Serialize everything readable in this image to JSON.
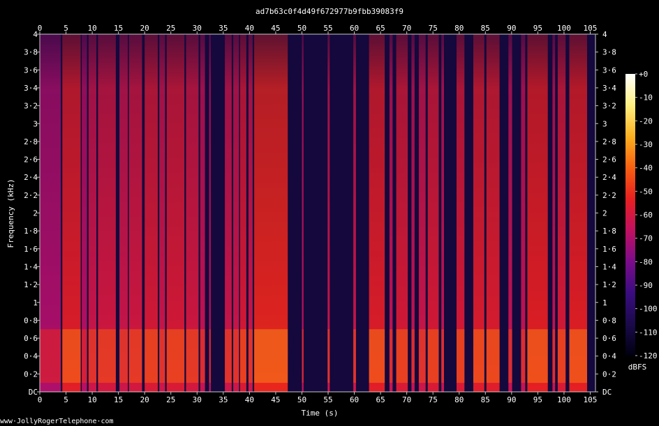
{
  "chart_data": {
    "type": "heatmap",
    "title": "ad7b63c0f4d49f672977b9fbb39083f9",
    "xlabel": "Time (s)",
    "ylabel": "Frequency (kHz)",
    "xlim": [
      0,
      106
    ],
    "ylim": [
      0,
      4
    ],
    "x_ticks": [
      "0",
      "5",
      "10",
      "15",
      "20",
      "25",
      "30",
      "35",
      "40",
      "45",
      "50",
      "55",
      "60",
      "65",
      "70",
      "75",
      "80",
      "85",
      "90",
      "95",
      "100",
      "105"
    ],
    "y_ticks": [
      "DC",
      "0·2",
      "0·4",
      "0·6",
      "0·8",
      "1",
      "1·2",
      "1·4",
      "1·6",
      "1·8",
      "2",
      "2·2",
      "2·4",
      "2·6",
      "2·8",
      "3",
      "3·2",
      "3·4",
      "3·6",
      "3·8",
      "4"
    ],
    "colorbar": {
      "label": "dBFS",
      "ticks": [
        "+0",
        "-10",
        "-20",
        "-30",
        "-40",
        "-50",
        "-60",
        "-70",
        "-80",
        "-90",
        "-100",
        "-110",
        "-120"
      ],
      "range": [
        -120,
        0
      ],
      "colors": [
        "#000010",
        "#1a0a4a",
        "#3a0c80",
        "#7a0c8a",
        "#c01060",
        "#e82020",
        "#f86010",
        "#fcb020",
        "#fff080",
        "#ffffff"
      ]
    },
    "background_level_dbfs": -110,
    "speech_segments": [
      {
        "start": 0.0,
        "end": 4.0,
        "level": -70
      },
      {
        "start": 4.3,
        "end": 7.8,
        "level": -55
      },
      {
        "start": 8.0,
        "end": 9.0,
        "level": -68
      },
      {
        "start": 9.3,
        "end": 10.8,
        "level": -62
      },
      {
        "start": 11.1,
        "end": 14.5,
        "level": -60
      },
      {
        "start": 15.2,
        "end": 16.8,
        "level": -62
      },
      {
        "start": 17.0,
        "end": 19.5,
        "level": -60
      },
      {
        "start": 20.0,
        "end": 22.5,
        "level": -58
      },
      {
        "start": 22.8,
        "end": 23.9,
        "level": -62
      },
      {
        "start": 24.2,
        "end": 27.6,
        "level": -58
      },
      {
        "start": 27.9,
        "end": 30.3,
        "level": -60
      },
      {
        "start": 30.6,
        "end": 31.5,
        "level": -64
      },
      {
        "start": 32.3,
        "end": 32.6,
        "level": -66
      },
      {
        "start": 35.3,
        "end": 36.6,
        "level": -62
      },
      {
        "start": 36.9,
        "end": 38.0,
        "level": -62
      },
      {
        "start": 38.2,
        "end": 39.4,
        "level": -58
      },
      {
        "start": 39.8,
        "end": 40.6,
        "level": -62
      },
      {
        "start": 40.9,
        "end": 47.3,
        "level": -52
      },
      {
        "start": 50.0,
        "end": 50.3,
        "level": -66
      },
      {
        "start": 54.9,
        "end": 55.3,
        "level": -62
      },
      {
        "start": 59.8,
        "end": 60.3,
        "level": -62
      },
      {
        "start": 62.8,
        "end": 65.8,
        "level": -55
      },
      {
        "start": 66.7,
        "end": 67.3,
        "level": -64
      },
      {
        "start": 68.0,
        "end": 70.2,
        "level": -58
      },
      {
        "start": 70.9,
        "end": 71.5,
        "level": -64
      },
      {
        "start": 72.3,
        "end": 73.6,
        "level": -62
      },
      {
        "start": 74.0,
        "end": 76.1,
        "level": -58
      },
      {
        "start": 76.6,
        "end": 77.1,
        "level": -64
      },
      {
        "start": 79.5,
        "end": 81.0,
        "level": -58
      },
      {
        "start": 82.7,
        "end": 84.8,
        "level": -56
      },
      {
        "start": 85.2,
        "end": 87.7,
        "level": -56
      },
      {
        "start": 89.4,
        "end": 90.1,
        "level": -64
      },
      {
        "start": 91.8,
        "end": 92.6,
        "level": -64
      },
      {
        "start": 93.0,
        "end": 96.9,
        "level": -54
      },
      {
        "start": 97.8,
        "end": 98.3,
        "level": -64
      },
      {
        "start": 98.8,
        "end": 100.3,
        "level": -58
      },
      {
        "start": 101.0,
        "end": 104.4,
        "level": -54
      }
    ]
  },
  "footer": {
    "site": "www·JollyRogerTelephone·com"
  }
}
